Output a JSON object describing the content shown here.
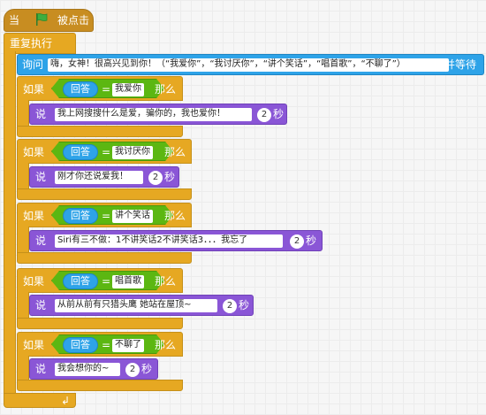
{
  "hat": {
    "when_label": "当",
    "clicked_label": "被点击",
    "flag_color": "#3fae3f"
  },
  "forever": {
    "label": "重复执行"
  },
  "ask": {
    "label": "询问",
    "question": "嗨，女神！很高兴见到你！（“我爱你”，“我讨厌你”，“讲个笑话”，“唱首歌”，“不聊了”）",
    "wait_label": "并等待"
  },
  "if_blocks": [
    {
      "if_label": "如果",
      "answer_label": "回答",
      "equals": "=",
      "value": "我爱你",
      "then_label": "那么",
      "say_label": "说",
      "message": "我上网搜搜什么是爱，骗你的，我也爱你！",
      "secs": "2",
      "secs_label": "秒"
    },
    {
      "if_label": "如果",
      "answer_label": "回答",
      "equals": "=",
      "value": "我讨厌你",
      "then_label": "那么",
      "say_label": "说",
      "message": "刚才你还说爱我！",
      "secs": "2",
      "secs_label": "秒"
    },
    {
      "if_label": "如果",
      "answer_label": "回答",
      "equals": "=",
      "value": "讲个笑话",
      "then_label": "那么",
      "say_label": "说",
      "message": "Siri有三不做：1不讲笑话2不讲笑话3．．．我忘了",
      "secs": "2",
      "secs_label": "秒"
    },
    {
      "if_label": "如果",
      "answer_label": "回答",
      "equals": "=",
      "value": "唱首歌",
      "then_label": "那么",
      "say_label": "说",
      "message": "从前从前有只猎头鹰  她站在屋顶~",
      "secs": "2",
      "secs_label": "秒"
    },
    {
      "if_label": "如果",
      "answer_label": "回答",
      "equals": "=",
      "value": "不聊了",
      "then_label": "那么",
      "say_label": "说",
      "message": "我会想你的~",
      "secs": "2",
      "secs_label": "秒"
    }
  ],
  "loop_arrow": "↲"
}
